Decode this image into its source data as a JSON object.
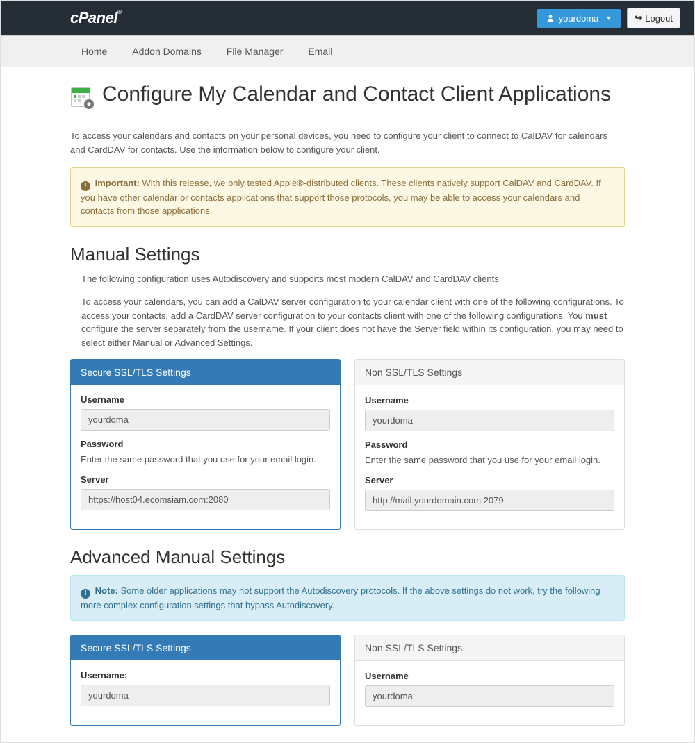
{
  "header": {
    "brand": "cPanel",
    "user_label": "yourdoma",
    "logout_label": "Logout"
  },
  "nav": {
    "home": "Home",
    "addon": "Addon Domains",
    "filemanager": "File Manager",
    "email": "Email"
  },
  "page": {
    "title": "Configure My Calendar and Contact Client Applications",
    "intro": "To access your calendars and contacts on your personal devices, you need to configure your client to connect to CalDAV for calendars and CardDAV for contacts. Use the information below to configure your client."
  },
  "important": {
    "label": "Important:",
    "text": "With this release, we only tested Apple®-distributed clients. These clients natively support CalDAV and CardDAV. If you have other calendar or contacts applications that support those protocols, you may be able to access your calendars and contacts from those applications."
  },
  "manual": {
    "heading": "Manual Settings",
    "p1": "The following configuration uses Autodiscovery and supports most modern CalDAV and CardDAV clients.",
    "p2a": "To access your calendars, you can add a CalDAV server configuration to your calendar client with one of the following configurations. To access your contacts, add a CardDAV server configuration to your contacts client with one of the following configurations. You ",
    "p2b": "must",
    "p2c": " configure the server separately from the username. If your client does not have the Server field within its configuration, you may need to select either Manual or Advanced Settings."
  },
  "labels": {
    "username": "Username",
    "username_colon": "Username:",
    "password": "Password",
    "password_desc": "Enter the same password that you use for your email login.",
    "server": "Server"
  },
  "secure": {
    "title": "Secure SSL/TLS Settings",
    "username": "yourdoma",
    "server": "https://host04.ecomsiam.com:2080"
  },
  "nonsecure": {
    "title": "Non SSL/TLS Settings",
    "username": "yourdoma",
    "server": "http://mail.yourdomain.com:2079"
  },
  "advanced": {
    "heading": "Advanced Manual Settings"
  },
  "note": {
    "label": "Note:",
    "text": "Some older applications may not support the Autodiscovery protocols. If the above settings do not work, try the following more complex configuration settings that bypass Autodiscovery."
  },
  "adv_secure": {
    "username": "yourdoma"
  },
  "adv_nonsecure": {
    "username": "yourdoma"
  }
}
